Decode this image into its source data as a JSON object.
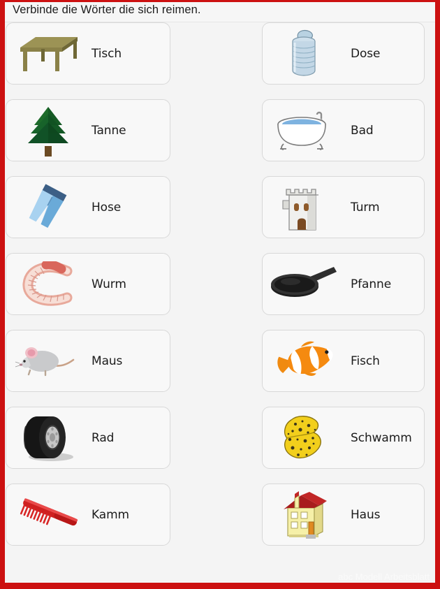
{
  "page": {
    "title": "Verbinde die Wörter die sich reimen.",
    "border_color": "#cc1111",
    "background_color": "#f4f4f4",
    "watermark": "abc Modell Arbeitsblatt"
  },
  "left_column": [
    {
      "label": "Tisch",
      "icon": "table-icon"
    },
    {
      "label": "Tanne",
      "icon": "fir-tree-icon"
    },
    {
      "label": "Hose",
      "icon": "jeans-icon"
    },
    {
      "label": "Wurm",
      "icon": "worm-icon"
    },
    {
      "label": "Maus",
      "icon": "mouse-icon"
    },
    {
      "label": "Rad",
      "icon": "tire-icon"
    },
    {
      "label": "Kamm",
      "icon": "comb-icon"
    }
  ],
  "right_column": [
    {
      "label": "Dose",
      "icon": "tin-can-icon"
    },
    {
      "label": "Bad",
      "icon": "bathtub-icon"
    },
    {
      "label": "Turm",
      "icon": "tower-icon"
    },
    {
      "label": "Pfanne",
      "icon": "frying-pan-icon"
    },
    {
      "label": "Fisch",
      "icon": "clownfish-icon"
    },
    {
      "label": "Schwamm",
      "icon": "sponge-icon"
    },
    {
      "label": "Haus",
      "icon": "house-icon"
    }
  ]
}
